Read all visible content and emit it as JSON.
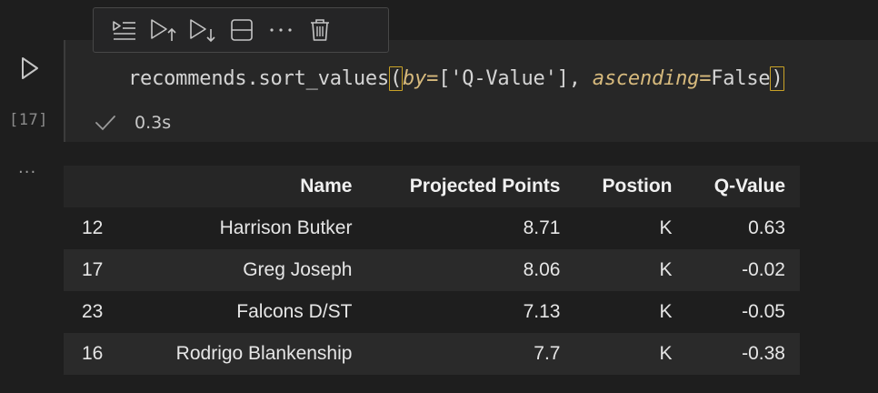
{
  "cell": {
    "execution_count": "[17]",
    "code": {
      "prefix": "recommends.sort_values",
      "open_paren": "(",
      "kw_by": "by",
      "eq1": "=",
      "by_value": "['Q-Value']",
      "comma": ", ",
      "kw_ascending": "ascending",
      "eq2": "=",
      "ascending_value": "False",
      "close_paren": ")"
    },
    "status": {
      "duration": "0.3s"
    }
  },
  "toolbar": {
    "items": [
      {
        "icon": "run-by-line-icon"
      },
      {
        "icon": "execute-above-icon"
      },
      {
        "icon": "execute-below-icon"
      },
      {
        "icon": "split-cell-icon"
      },
      {
        "icon": "more-icon"
      },
      {
        "icon": "delete-icon"
      }
    ]
  },
  "output": {
    "dots": "...",
    "table": {
      "columns": [
        "",
        "Name",
        "Projected Points",
        "Postion",
        "Q-Value"
      ],
      "rows": [
        [
          "12",
          "Harrison Butker",
          "8.71",
          "K",
          "0.63"
        ],
        [
          "17",
          "Greg Joseph",
          "8.06",
          "K",
          "-0.02"
        ],
        [
          "23",
          "Falcons D/ST",
          "7.13",
          "K",
          "-0.05"
        ],
        [
          "16",
          "Rodrigo Blankenship",
          "7.7",
          "K",
          "-0.38"
        ]
      ]
    }
  },
  "colors": {
    "background": "#1e1e1e",
    "editor_bg": "#272727",
    "bracket_highlight": "#c9a227",
    "keyword": "#d7ba7d"
  }
}
